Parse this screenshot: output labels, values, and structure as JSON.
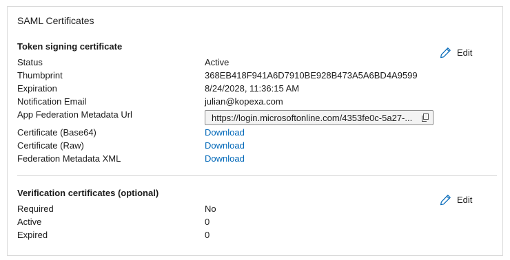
{
  "card": {
    "title": "SAML Certificates"
  },
  "token_signing": {
    "heading": "Token signing certificate",
    "edit_label": "Edit",
    "rows": {
      "status": {
        "label": "Status",
        "value": "Active"
      },
      "thumbprint": {
        "label": "Thumbprint",
        "value": "368EB418F941A6D7910BE928B473A5A6BD4A9599"
      },
      "expiration": {
        "label": "Expiration",
        "value": "8/24/2028, 11:36:15 AM"
      },
      "notification_email": {
        "label": "Notification Email",
        "value": "julian@kopexa.com"
      },
      "metadata_url": {
        "label": "App Federation Metadata Url",
        "value": "https://login.microsoftonline.com/4353fe0c-5a27-..."
      },
      "cert_base64": {
        "label": "Certificate (Base64)",
        "value": "Download"
      },
      "cert_raw": {
        "label": "Certificate (Raw)",
        "value": "Download"
      },
      "federation_xml": {
        "label": "Federation Metadata XML",
        "value": "Download"
      }
    }
  },
  "verification": {
    "heading": "Verification certificates (optional)",
    "edit_label": "Edit",
    "rows": {
      "required": {
        "label": "Required",
        "value": "No"
      },
      "active": {
        "label": "Active",
        "value": "0"
      },
      "expired": {
        "label": "Expired",
        "value": "0"
      }
    }
  },
  "icons": {
    "edit": "pencil-icon",
    "copy": "copy-icon"
  },
  "colors": {
    "link": "#0067b8",
    "edit_icon": "#0067b8",
    "border": "#dadada",
    "url_box_bg": "#f3f3f3"
  }
}
